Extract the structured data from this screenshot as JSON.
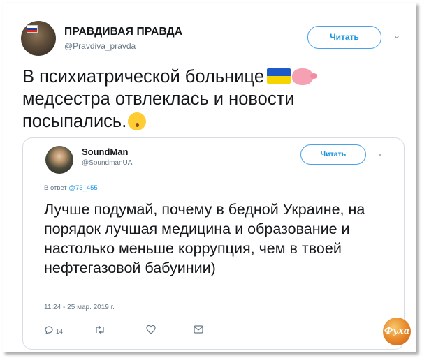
{
  "outer_tweet": {
    "display_name": "ПРАВДИВАЯ ПРАВДА",
    "handle": "@Pravdiva_pravda",
    "follow_label": "Читать",
    "text_line1": "В психиатрической больнице",
    "text_line2": "медсестра отвлеклась и новости",
    "text_line3": "посыпались."
  },
  "quoted_tweet": {
    "display_name": "SoundMan",
    "handle": "@SoundmanUA",
    "follow_label": "Читать",
    "reply_prefix": "В ответ",
    "reply_handle": "@73_455",
    "text": "Лучше подумай, почему в бедной Украине, на порядок лучшая медицина и образование и настолько меньше коррупция, чем в твоей нефтегазовой бабуинии)",
    "timestamp": "11:24 - 25 мар. 2019 г.",
    "reply_count": "14"
  },
  "icons": {
    "flag_emoji": "ukraine-flag-icon",
    "pig_emoji": "pig-icon",
    "face_emoji": "kissing-face-icon",
    "reply": "reply-icon",
    "retweet": "retweet-icon",
    "like": "heart-icon",
    "dm": "direct-message-icon",
    "chevron": "chevron-down-icon"
  },
  "colors": {
    "accent": "#1b95e0",
    "muted": "#657786",
    "text": "#14171a"
  }
}
